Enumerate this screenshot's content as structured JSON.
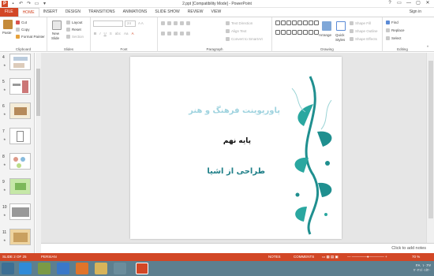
{
  "window": {
    "title": "2.ppt [Compatibility Mode] - PowerPoint",
    "app_icon": "P",
    "controls": [
      "?",
      "▭",
      "—",
      "▢",
      "✕"
    ],
    "signin": "Sign in"
  },
  "tabs": [
    "FILE",
    "HOME",
    "INSERT",
    "DESIGN",
    "TRANSITIONS",
    "ANIMATIONS",
    "SLIDE SHOW",
    "REVIEW",
    "VIEW"
  ],
  "ribbon": {
    "clipboard": {
      "label": "Clipboard",
      "paste": "Paste",
      "cut": "Cut",
      "copy": "Copy",
      "format_painter": "Format Painter"
    },
    "slides": {
      "label": "Slides",
      "new_slide": "New",
      "new_slide2": "Slide",
      "layout": "Layout",
      "reset": "Reset",
      "section": "Section"
    },
    "font": {
      "label": "Font",
      "size": "24",
      "bold": "B",
      "italic": "I",
      "underline": "U",
      "strike": "S",
      "abc": "abc",
      "aa": "Aa",
      "a": "A"
    },
    "paragraph": {
      "label": "Paragraph",
      "text_direction": "Text Direction",
      "align_text": "Align Text",
      "smartart": "Convert to SmartArt"
    },
    "drawing": {
      "label": "Drawing",
      "arrange": "Arrange",
      "quick_styles": "Quick",
      "quick_styles2": "Styles",
      "shape_fill": "Shape Fill",
      "shape_outline": "Shape Outline",
      "shape_effects": "Shape Effects"
    },
    "editing": {
      "label": "Editing",
      "find": "Find",
      "replace": "Replace",
      "select": "Select"
    }
  },
  "thumbnails": [
    {
      "num": "4"
    },
    {
      "num": "5"
    },
    {
      "num": "6"
    },
    {
      "num": "7"
    },
    {
      "num": "8"
    },
    {
      "num": "9"
    },
    {
      "num": "10"
    },
    {
      "num": "11"
    }
  ],
  "thumb_star": "★",
  "slide": {
    "line1": "پاورپوینت فرهنگ و هنر",
    "line2": "پایه نهم",
    "line3": "طراحی از اشیا"
  },
  "notes": {
    "placeholder": "Click to add notes"
  },
  "status": {
    "slide_of": "SLIDE 2 OF 25",
    "language": "PERSIAN",
    "notes": "NOTES",
    "comments": "COMMENTS",
    "zoom": "70 %"
  },
  "taskbar": {
    "lang": "FA",
    "time": "۱۰:۴۷",
    "date": "۲۰۲۱/۰۱/۲۰"
  }
}
